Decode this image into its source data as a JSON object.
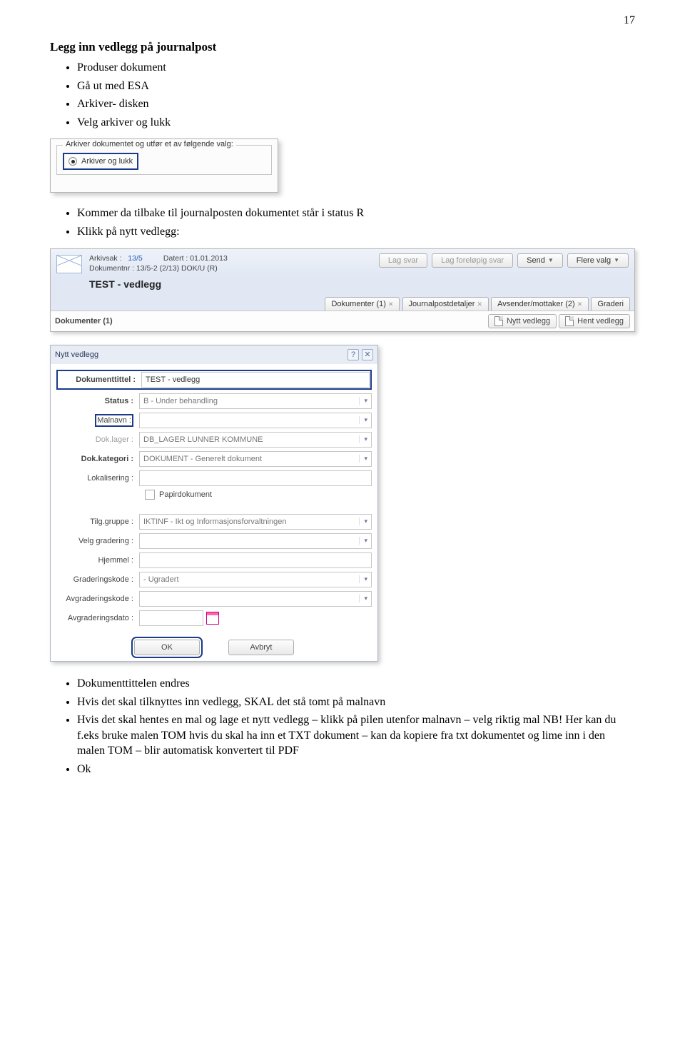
{
  "page_number": "17",
  "heading": "Legg inn vedlegg på journalpost",
  "list1": [
    "Produser dokument",
    "Gå ut med ESA",
    "Arkiver- disken",
    "Velg arkiver og lukk"
  ],
  "list2": [
    "Kommer da tilbake til journalposten dokumentet står i status R",
    "Klikk på nytt vedlegg:"
  ],
  "list3": [
    "Dokumenttittelen endres",
    "Hvis det skal tilknyttes inn vedlegg, SKAL det stå tomt på malnavn",
    "Hvis det skal hentes en mal og lage et nytt vedlegg – klikk på pilen utenfor malnavn – velg riktig mal NB! Her kan du f.eks bruke malen TOM hvis du skal ha inn et TXT dokument – kan da kopiere fra txt dokumentet og lime inn i den malen TOM – blir automatisk konvertert til PDF",
    "Ok"
  ],
  "archive_dialog": {
    "legend": "Arkiver dokumentet og utfør et av følgende valg:",
    "option": "Arkiver og lukk"
  },
  "toolbar": {
    "arkivsak_lbl": "Arkivsak :",
    "arkivsak_val": "13/5",
    "datert_lbl": "Datert : 01.01.2013",
    "doknr_lbl": "Dokumentnr : 13/5-2 (2/13) DOK/U (R)",
    "title": "TEST - vedlegg",
    "btn_lagsvar": "Lag svar",
    "btn_lagforelop": "Lag foreløpig svar",
    "btn_send": "Send",
    "btn_flere": "Flere valg",
    "tab_dok": "Dokumenter (1)",
    "tab_jpd": "Journalpostdetaljer",
    "tab_avs": "Avsender/mottaker (2)",
    "tab_grad": "Graderi",
    "sub_left": "Dokumenter (1)",
    "sub_btn_nytt": "Nytt vedlegg",
    "sub_btn_hent": "Hent vedlegg"
  },
  "modal": {
    "title": "Nytt vedlegg",
    "fields": {
      "doktittel_lbl": "Dokumenttittel :",
      "doktittel_val": "TEST - vedlegg",
      "status_lbl": "Status :",
      "status_val": "B - Under behandling",
      "malnavn_lbl": "Malnavn :",
      "malnavn_val": "",
      "doklager_lbl": "Dok.lager :",
      "doklager_val": "DB_LAGER LUNNER KOMMUNE",
      "dokkat_lbl": "Dok.kategori :",
      "dokkat_val": "DOKUMENT - Generelt dokument",
      "lokal_lbl": "Lokalisering :",
      "papir_lbl": "Papirdokument",
      "tilg_lbl": "Tilg.gruppe :",
      "tilg_val": "IKTINF - Ikt og Informasjonsforvaltningen",
      "velggrad_lbl": "Velg gradering :",
      "hjemmel_lbl": "Hjemmel :",
      "gradkode_lbl": "Graderingskode :",
      "gradkode_val": "- Ugradert",
      "avgradkode_lbl": "Avgraderingskode :",
      "avgraddato_lbl": "Avgraderingsdato :"
    },
    "btn_ok": "OK",
    "btn_avbryt": "Avbryt"
  }
}
